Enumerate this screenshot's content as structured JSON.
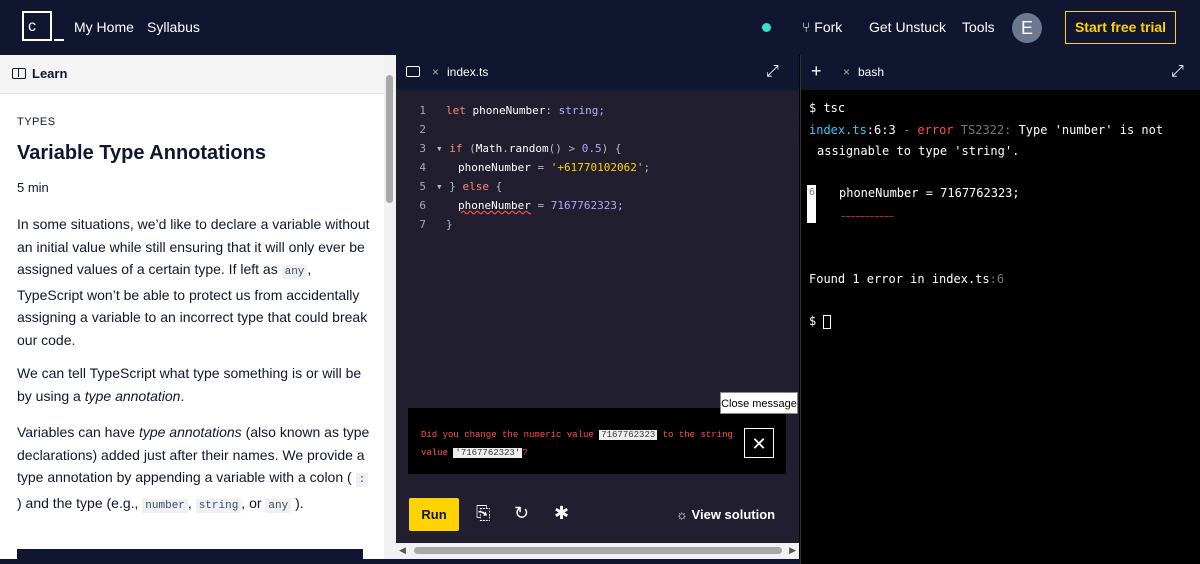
{
  "topbar": {
    "logo_text": "c",
    "nav": [
      "My Home",
      "Syllabus"
    ],
    "fork": "Fork",
    "get_unstuck": "Get Unstuck",
    "tools": "Tools",
    "avatar": "E",
    "trial": "Start free trial"
  },
  "lesson": {
    "tab": "Learn",
    "category": "TYPES",
    "title": "Variable Type Annotations",
    "duration": "5 min",
    "p1_a": "In some situations, we’d like to declare a variable without an initial value while still ensuring that it will only ever be assigned values of a certain type. If left as",
    "p1_code": "any",
    "p1_b": ", TypeScript won’t be able to protect us from accidentally assigning a variable to an incorrect type that could break our code.",
    "p2_a": "We can tell TypeScript what type something is or will be by using a",
    "p2_em": "type annotation",
    "p2_b": ".",
    "p3_a": "Variables can have",
    "p3_em": "type annotations",
    "p3_b": "(also known as type declarations) added just after their names. We provide a type annotation by appending a variable with a colon (",
    "p3_code1": ":",
    "p3_c": ") and the type (e.g.,",
    "p3_code2": "number",
    "p3_d": ",",
    "p3_code3": "string",
    "p3_e": ", or",
    "p3_code4": "any",
    "p3_f": ")."
  },
  "editor": {
    "filename": "index.ts",
    "line_numbers": [
      "1",
      "2",
      "3",
      "4",
      "5",
      "6",
      "7"
    ],
    "message_a": "Did you change the numeric value",
    "message_code1": "7167762323",
    "message_b": "to the string value",
    "message_code2": "'7167762323'",
    "message_c": "?",
    "close_message": "Close message",
    "run": "Run",
    "view_solution": "View solution"
  },
  "terminal": {
    "tab": "bash",
    "cmd": "$ tsc",
    "err_file": "index.ts",
    "err_loc": ":6:3",
    "err_word": "error",
    "err_code": "TS2322:",
    "err_msg1": "Type 'number' is not",
    "err_msg2": "assignable to type 'string'.",
    "line_no": "6",
    "line_code": "phoneNumber = 7167762323;",
    "tildes": "~~~~~~~~~~~",
    "found": "Found 1 error in index.ts",
    "found_loc": ":6",
    "prompt": "$"
  }
}
